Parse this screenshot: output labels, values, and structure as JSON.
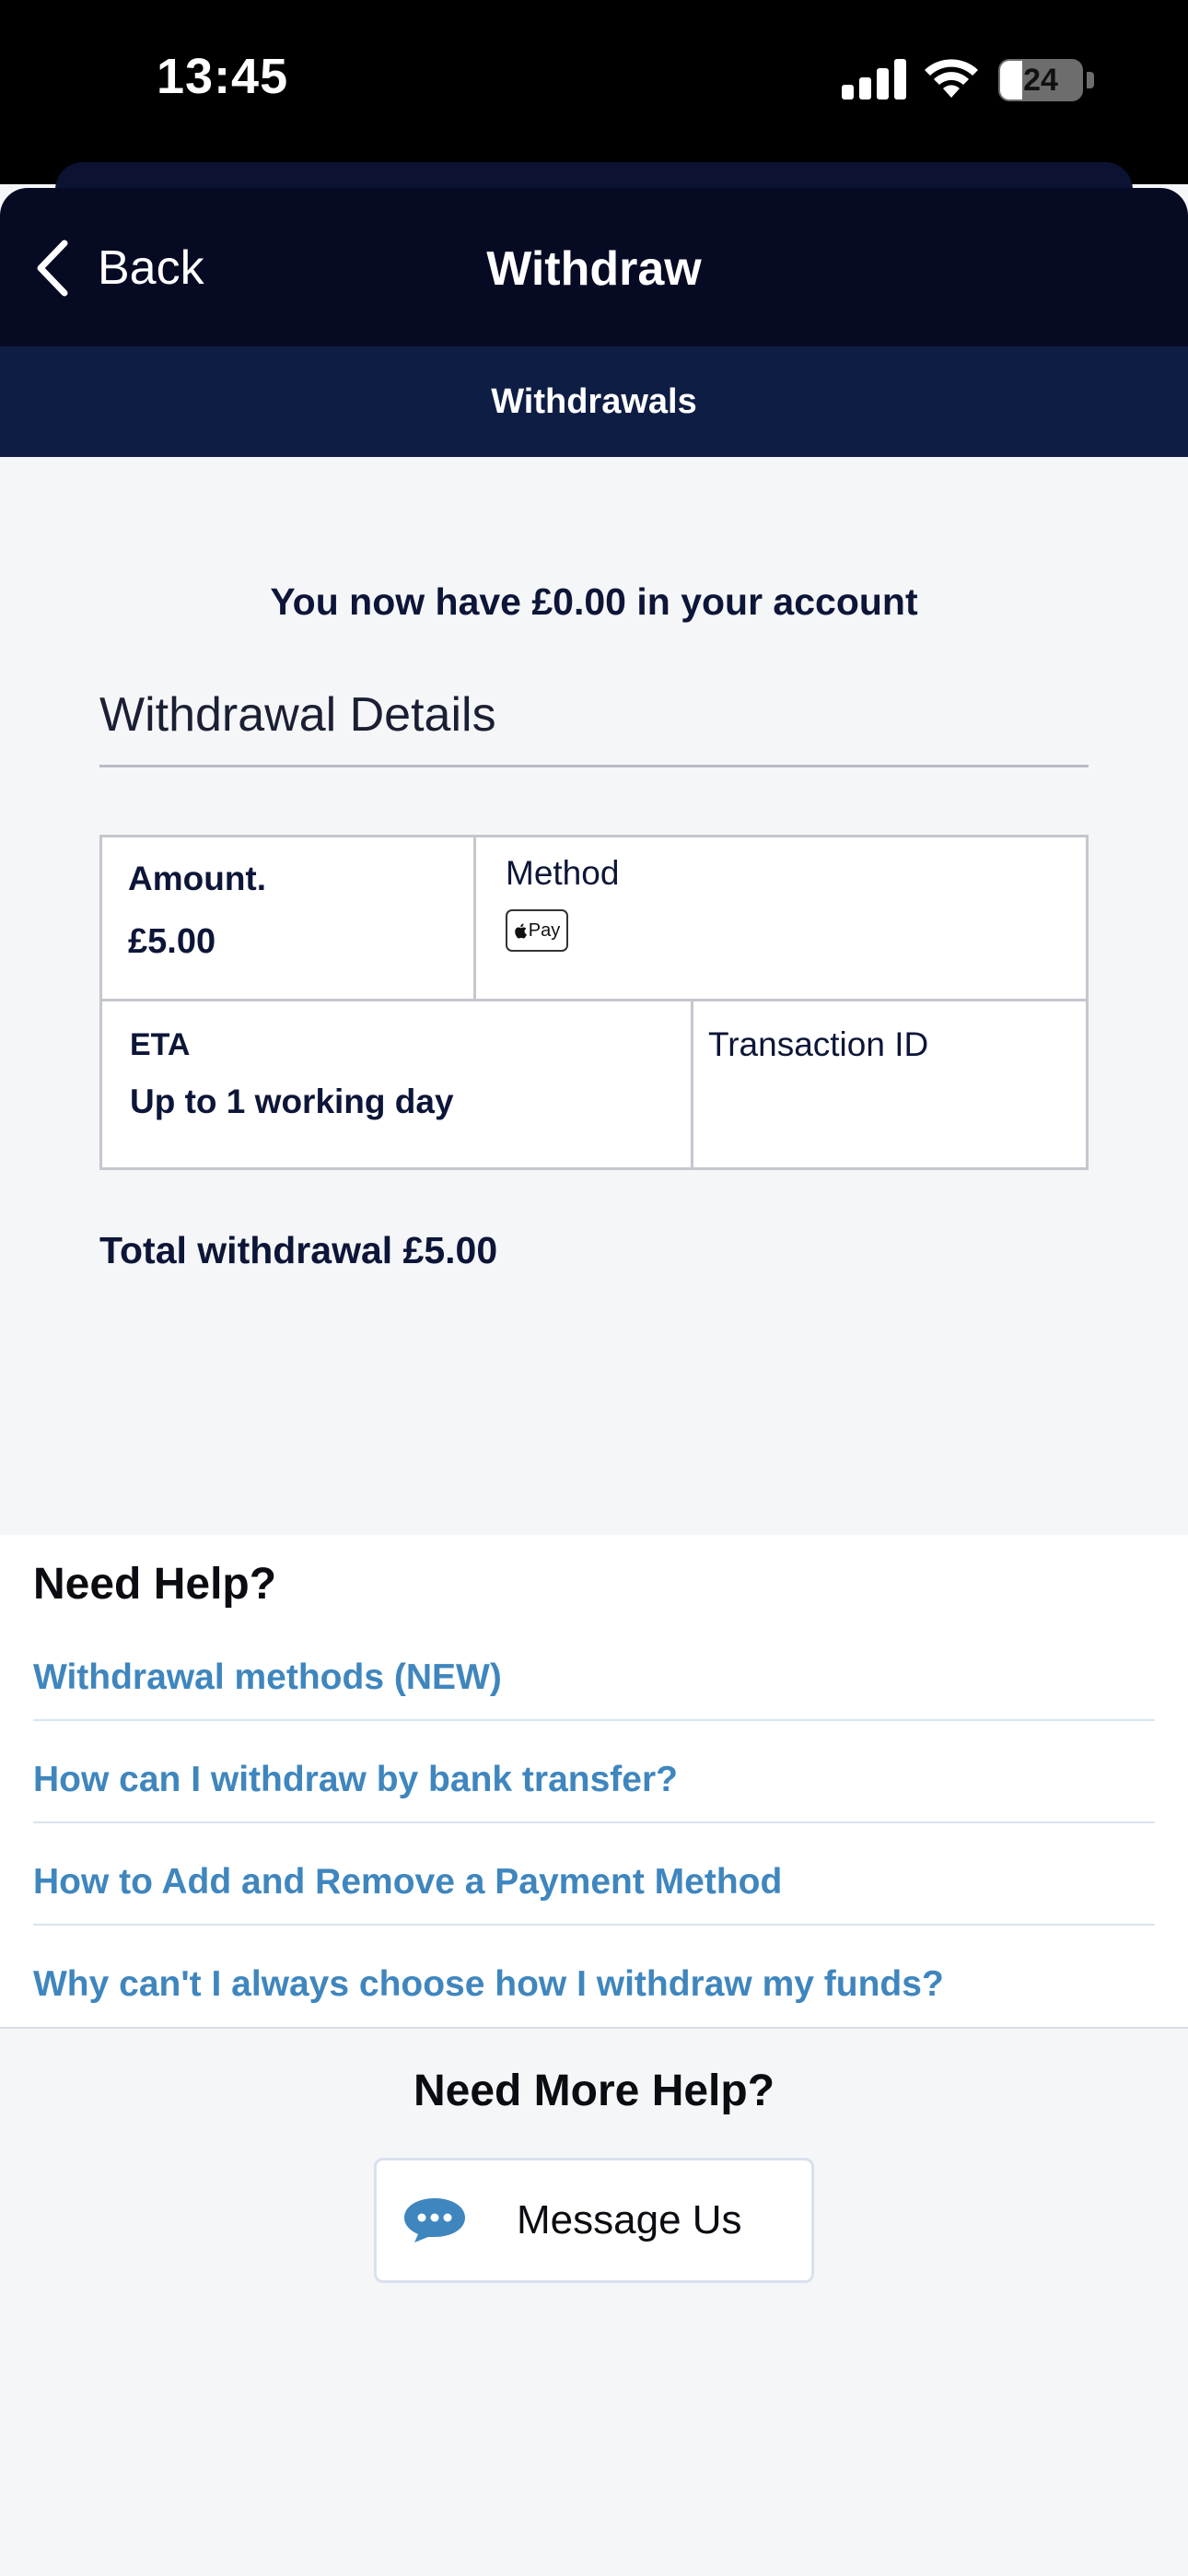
{
  "status_bar": {
    "time": "13:45",
    "battery": "24"
  },
  "header": {
    "back_label": "Back",
    "title": "Withdraw"
  },
  "subnav": {
    "tab_label": "Withdrawals"
  },
  "main": {
    "balance_text": "You now have £0.00 in your account",
    "details_title": "Withdrawal Details",
    "details": {
      "amount_label": "Amount.",
      "amount_value": "£5.00",
      "method_label": "Method",
      "method_icon": "apple-pay-icon",
      "method_badge": " Pay",
      "eta_label": "ETA",
      "eta_value": "Up to 1 working day",
      "transaction_label": "Transaction ID"
    },
    "total_text": "Total withdrawal £5.00"
  },
  "help": {
    "title": "Need Help?",
    "links": [
      {
        "label": "Withdrawal methods (NEW)"
      },
      {
        "label": "How can I withdraw by bank transfer?"
      },
      {
        "label": "How to Add and Remove a Payment Method"
      },
      {
        "label": "Why can't I always choose how I withdraw my funds?"
      }
    ]
  },
  "more_help": {
    "title": "Need More Help?",
    "button_label": "Message Us",
    "button_icon": "chat-bubble-icon"
  },
  "colors": {
    "header_bg": "#060a23",
    "subnav_bg": "#0e1d44",
    "link": "#3f86be",
    "text_dark": "#0d1638"
  }
}
